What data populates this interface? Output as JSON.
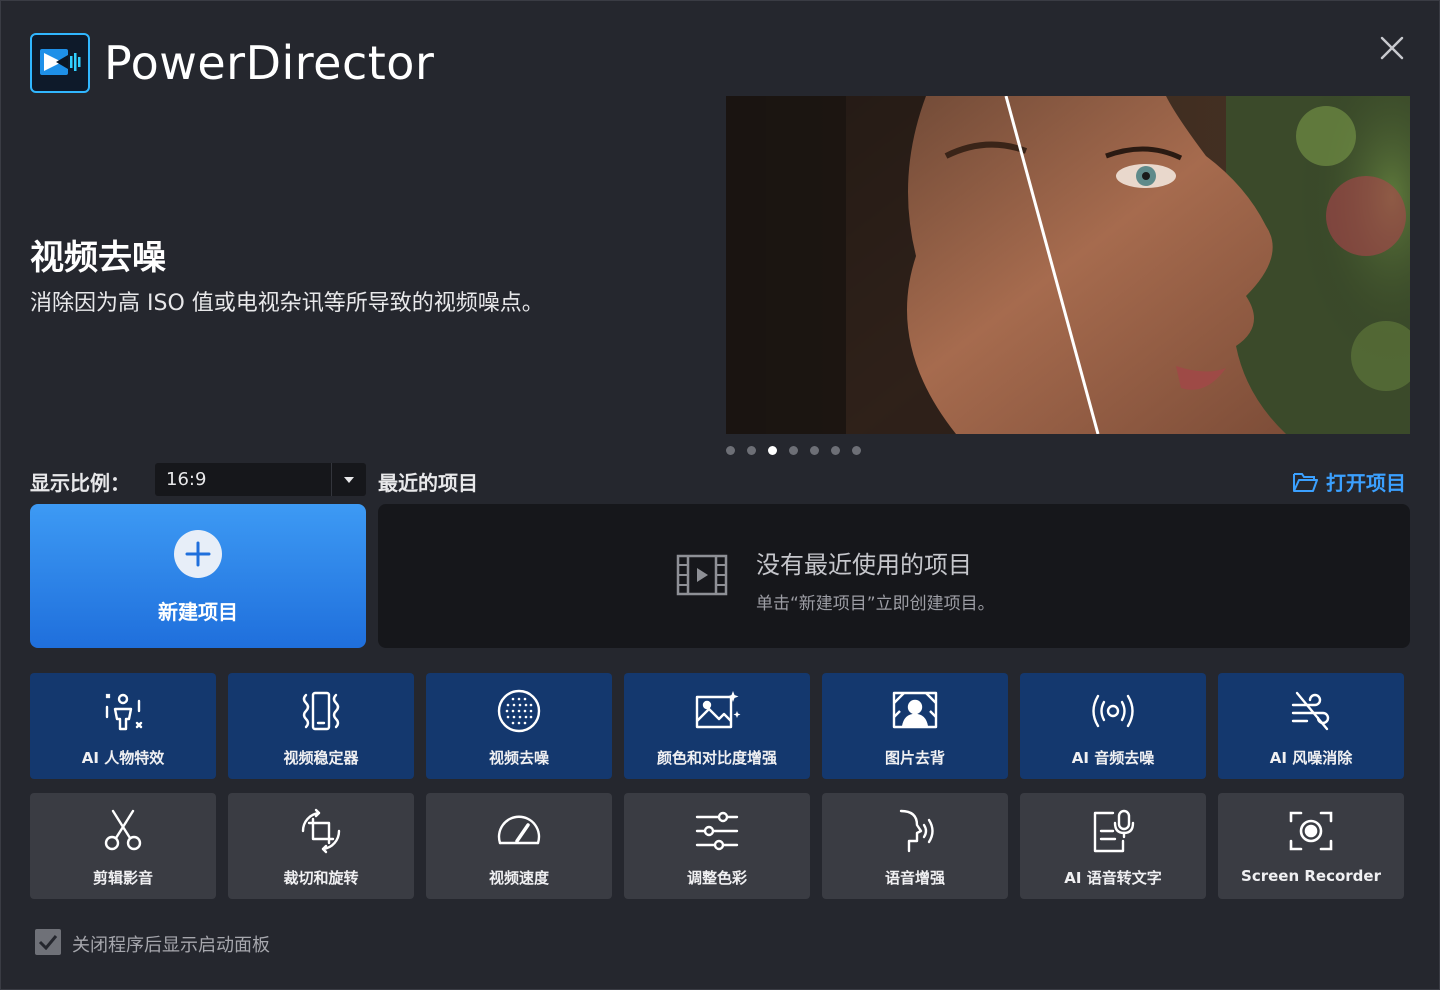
{
  "app": {
    "title": "PowerDirector"
  },
  "feature": {
    "title": "视频去噪",
    "description": "消除因为高 ISO 值或电视杂讯等所导致的视频噪点。"
  },
  "carousel": {
    "count": 7,
    "active_index": 2
  },
  "ratio": {
    "label": "显示比例：",
    "value": "16:9"
  },
  "recent": {
    "label": "最近的项目",
    "open_label": "打开项目",
    "empty_title": "没有最近使用的项目",
    "empty_hint": "单击“新建项目”立即创建项目。"
  },
  "new_project": {
    "label": "新建项目"
  },
  "tools": [
    {
      "label": "AI 人物特效",
      "icon": "ai-person-effect-icon",
      "style": "blue"
    },
    {
      "label": "视频稳定器",
      "icon": "stabilizer-icon",
      "style": "blue"
    },
    {
      "label": "视频去噪",
      "icon": "denoise-icon",
      "style": "blue"
    },
    {
      "label": "颜色和对比度增强",
      "icon": "color-enhance-icon",
      "style": "blue"
    },
    {
      "label": "图片去背",
      "icon": "remove-background-icon",
      "style": "blue"
    },
    {
      "label": "AI 音频去噪",
      "icon": "audio-denoise-icon",
      "style": "blue"
    },
    {
      "label": "AI 风噪消除",
      "icon": "wind-removal-icon",
      "style": "blue"
    },
    {
      "label": "剪辑影音",
      "icon": "scissors-icon",
      "style": "gray"
    },
    {
      "label": "裁切和旋转",
      "icon": "crop-rotate-icon",
      "style": "gray"
    },
    {
      "label": "视频速度",
      "icon": "speedometer-icon",
      "style": "gray"
    },
    {
      "label": "调整色彩",
      "icon": "sliders-icon",
      "style": "gray"
    },
    {
      "label": "语音增强",
      "icon": "voice-enhance-icon",
      "style": "gray"
    },
    {
      "label": "AI 语音转文字",
      "icon": "speech-to-text-icon",
      "style": "gray"
    },
    {
      "label": "Screen Recorder",
      "icon": "screen-recorder-icon",
      "style": "gray"
    }
  ],
  "footer": {
    "checkbox_label": "关闭程序后显示启动面板",
    "checked": true
  },
  "colors": {
    "background": "#25272e",
    "accent": "#3ba0ff",
    "tool_blue": "#14386e",
    "tool_gray": "#3a3c43"
  }
}
